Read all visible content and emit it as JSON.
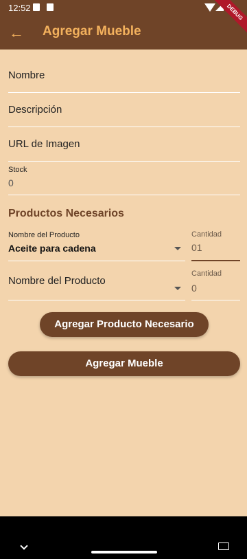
{
  "status_bar": {
    "time": "12:52",
    "icons": [
      "a-notification-icon",
      "sd-card-icon",
      "wifi-icon",
      "signal-icon",
      "battery-icon"
    ]
  },
  "app_bar": {
    "title": "Agregar Mueble",
    "back_icon": "arrow-back-icon",
    "debug_banner": "DEBUG"
  },
  "form": {
    "name_label": "Nombre",
    "description_label": "Descripción",
    "image_url_label": "URL de Imagen",
    "stock": {
      "label": "Stock",
      "value": "0"
    }
  },
  "products_section": {
    "title": "Productos Necesarios",
    "rows": [
      {
        "product_label": "Nombre del Producto",
        "product_value": "Aceite para cadena",
        "quantity_label": "Cantidad",
        "quantity_value": "01"
      },
      {
        "product_label": "Nombre del Producto",
        "product_value": "",
        "quantity_label": "Cantidad",
        "quantity_value": "0"
      }
    ]
  },
  "buttons": {
    "add_product": "Agregar Producto Necesario",
    "add_furniture": "Agregar Mueble"
  },
  "nav_bar": {
    "icons": [
      "chevron-down-icon",
      "home-handle",
      "keyboard-icon"
    ]
  },
  "colors": {
    "primary": "#6f4428",
    "background": "#f3d4ad",
    "accent": "#f3b15d",
    "debug": "#b0182a"
  }
}
